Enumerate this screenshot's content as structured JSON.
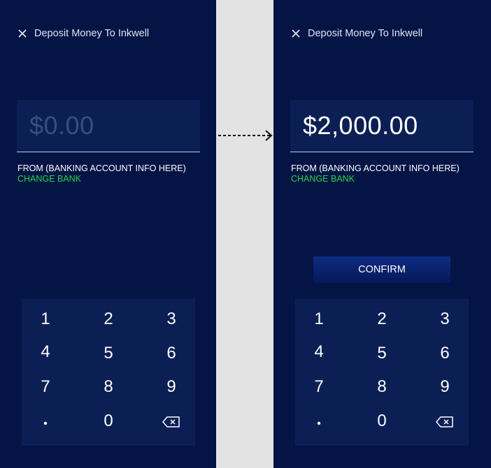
{
  "left_screen": {
    "title": "Deposit Money To Inkwell",
    "amount_placeholder": "$0.00",
    "from_label": "FROM (BANKING ACCOUNT INFO HERE)",
    "change_bank_label": "CHANGE BANK",
    "keypad": {
      "row1": [
        "1",
        "2",
        "3"
      ],
      "row2": [
        "4",
        "5",
        "6"
      ],
      "row3": [
        "7",
        "8",
        "9"
      ],
      "row4": [
        ".",
        "0",
        "backspace-icon"
      ]
    }
  },
  "right_screen": {
    "title": "Deposit Money To Inkwell",
    "amount_value": "$2,000.00",
    "from_label": "FROM (BANKING ACCOUNT INFO HERE)",
    "change_bank_label": "CHANGE BANK",
    "confirm_label": "CONFIRM",
    "keypad": {
      "row1": [
        "1",
        "2",
        "3"
      ],
      "row2": [
        "4",
        "5",
        "6"
      ],
      "row3": [
        "7",
        "8",
        "9"
      ],
      "row4": [
        ".",
        "0",
        "backspace-icon"
      ]
    }
  },
  "colors": {
    "screen_background": "#041444",
    "field_background": "#0c1f55",
    "accent_green": "#22d64a",
    "confirm_button": "#0d2c82",
    "gutter": "#e3e3e3"
  },
  "icons": [
    "close-icon",
    "backspace-icon",
    "flow-arrow-icon"
  ]
}
